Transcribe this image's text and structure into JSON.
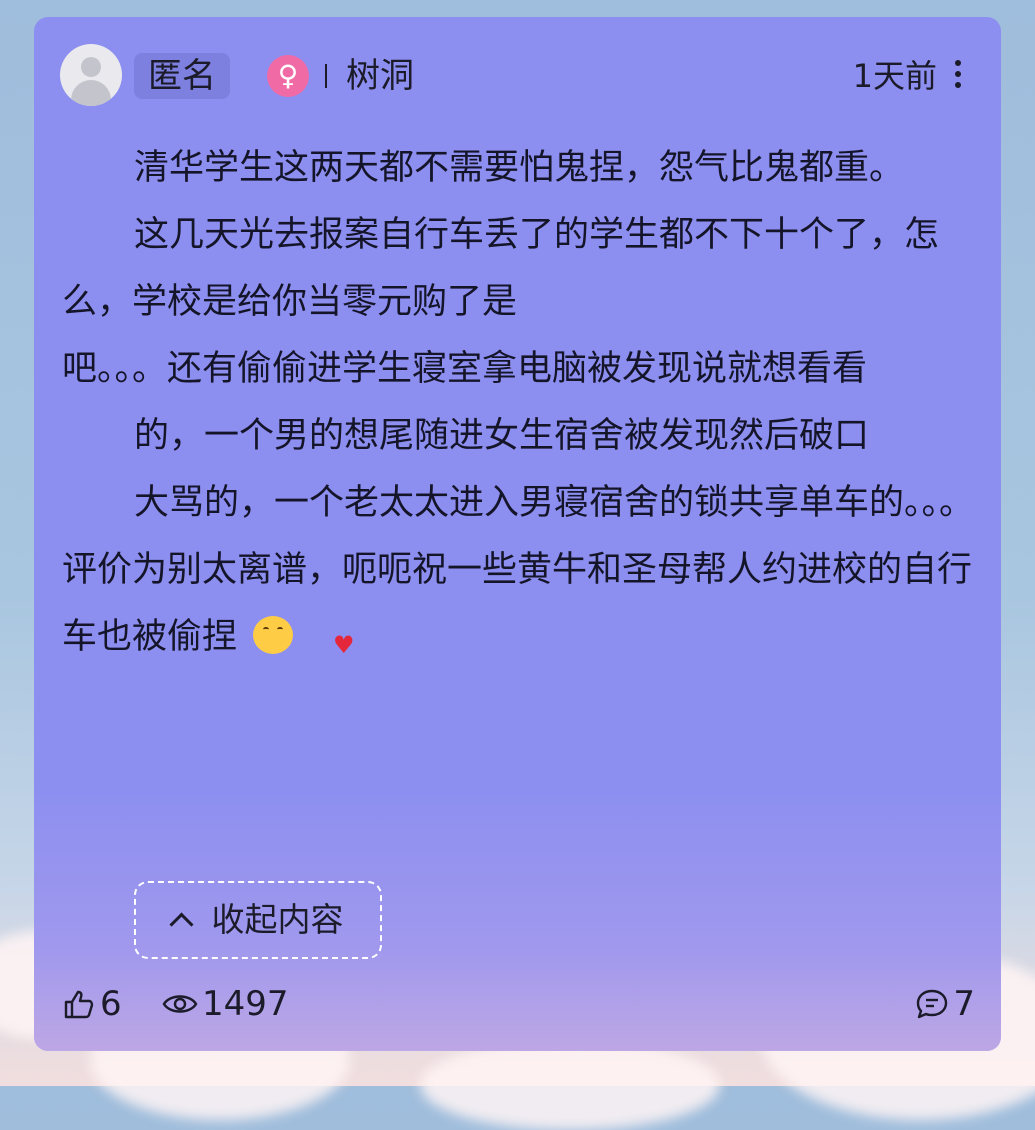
{
  "post": {
    "author_label": "匿名",
    "gender_symbol": "♀",
    "channel": "树洞",
    "time": "1天前",
    "paragraphs": [
      "清华学生这两天都不需要怕鬼捏，怨气比鬼都重。",
      "这几天光去报案自行车丢了的学生都不下十个了，怎么，学校是给你当零元购了是\n吧。。。还有偷偷进学生寝室拿电脑被发现说就想看看",
      "的，一个男的想尾随进女生宿舍被发现然后破口",
      "大骂的，一个老太太进入男寝宿舍的锁共享单车的。。。评价为别太离谱，呃呃祝一些黄牛和圣母帮人约进校的自行车也被偷捏"
    ],
    "emoji_icon": "hugging-face-heart-icon",
    "collapse_label": "收起内容",
    "likes": "6",
    "views": "1497",
    "comments": "7"
  },
  "colors": {
    "card_bg": "#8d8ff0",
    "gender_badge": "#f06aa6",
    "name_badge": "#7e80e0"
  }
}
